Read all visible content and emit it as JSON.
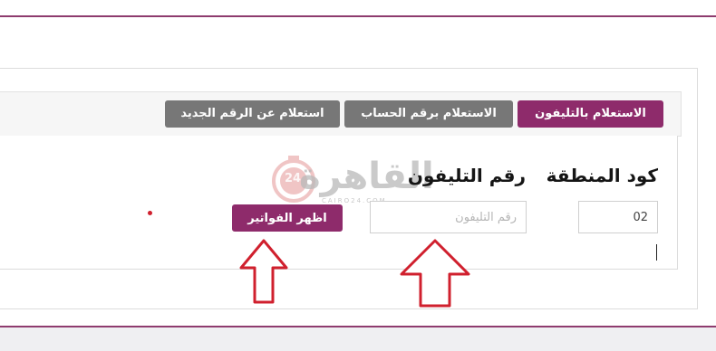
{
  "tabs": {
    "by_phone": "الاستعلام بالتليفون",
    "by_account": "الاستعلام برقم الحساب",
    "by_new_number": "استعلام عن الرقم الجديد"
  },
  "form": {
    "area_code_label": "كود المنطقة",
    "phone_label": "رقم التليفون",
    "area_code_value": "02",
    "phone_placeholder": "رقم التليفون",
    "submit_label": "اظهر الفواتير"
  },
  "watermark": {
    "brand_text": "القاهرة",
    "badge_number": "24",
    "sub_text": "CAIRO24.COM"
  },
  "colors": {
    "accent": "#8e2b6b",
    "tab_inactive": "#777777",
    "arrow": "#d0202e"
  }
}
